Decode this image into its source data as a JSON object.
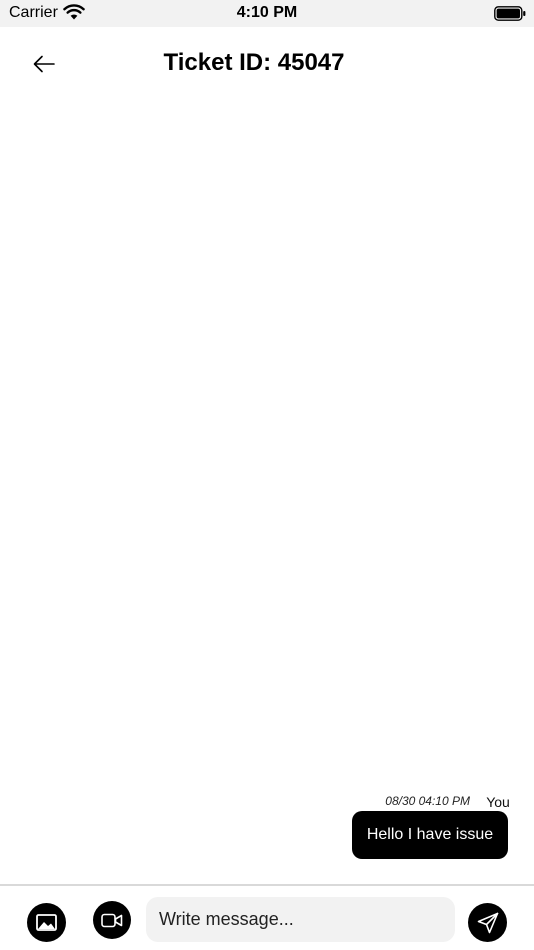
{
  "status_bar": {
    "carrier": "Carrier",
    "time": "4:10 PM"
  },
  "header": {
    "title": "Ticket ID: 45047",
    "back_icon": "arrow-left-icon"
  },
  "messages": [
    {
      "timestamp": "08/30 04:10 PM",
      "sender": "You",
      "text": "Hello I have issue"
    }
  ],
  "composer": {
    "placeholder": "Write message...",
    "value": "",
    "image_icon": "image-icon",
    "video_icon": "video-icon",
    "send_icon": "send-icon"
  },
  "colors": {
    "accent": "#000000",
    "bubble_text": "#ffffff",
    "input_bg": "#f2f2f2",
    "status_bar_bg": "#f2f2f2"
  }
}
